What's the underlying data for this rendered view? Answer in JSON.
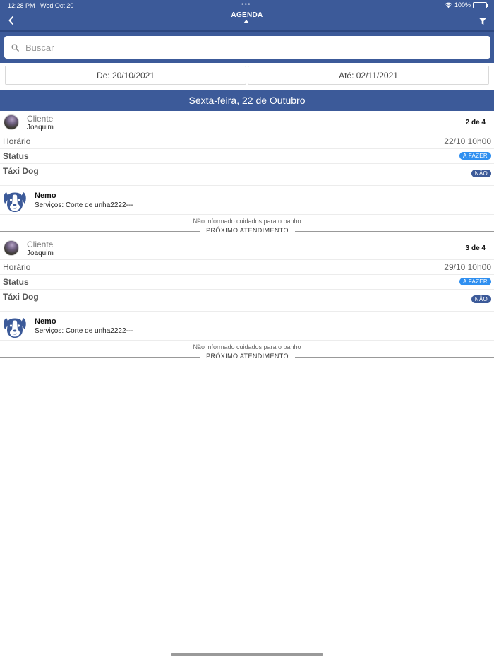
{
  "status_bar": {
    "time": "12:28 PM",
    "date": "Wed Oct 20",
    "battery": "100%"
  },
  "nav": {
    "title": "AGENDA"
  },
  "search": {
    "placeholder": "Buscar"
  },
  "date_range": {
    "from_label": "De: 20/10/2021",
    "to_label": "Até: 02/11/2021"
  },
  "day_header": "Sexta-feira, 22 de Outubro",
  "appointments": [
    {
      "client_label": "Cliente",
      "client_name": "Joaquim",
      "count": "2 de 4",
      "time_label": "Horário",
      "time_value": "22/10 10h00",
      "status_label": "Status",
      "status_value": "A FAZER",
      "taxi_label": "Táxi Dog",
      "taxi_value": "NÃO",
      "pet_name": "Nemo",
      "pet_services": "Serviços: Corte de unha2222---",
      "care_note": "Não informado cuidados para o banho",
      "next_label": "PRÓXIMO ATENDIMENTO"
    },
    {
      "client_label": "Cliente",
      "client_name": "Joaquim",
      "count": "3 de 4",
      "time_label": "Horário",
      "time_value": "29/10 10h00",
      "status_label": "Status",
      "status_value": "A FAZER",
      "taxi_label": "Táxi Dog",
      "taxi_value": "NÃO",
      "pet_name": "Nemo",
      "pet_services": "Serviços: Corte de unha2222---",
      "care_note": "Não informado cuidados para o banho",
      "next_label": "PRÓXIMO ATENDIMENTO"
    }
  ],
  "colors": {
    "primary": "#3c5a99",
    "todo_badge": "#2f8ff0"
  }
}
